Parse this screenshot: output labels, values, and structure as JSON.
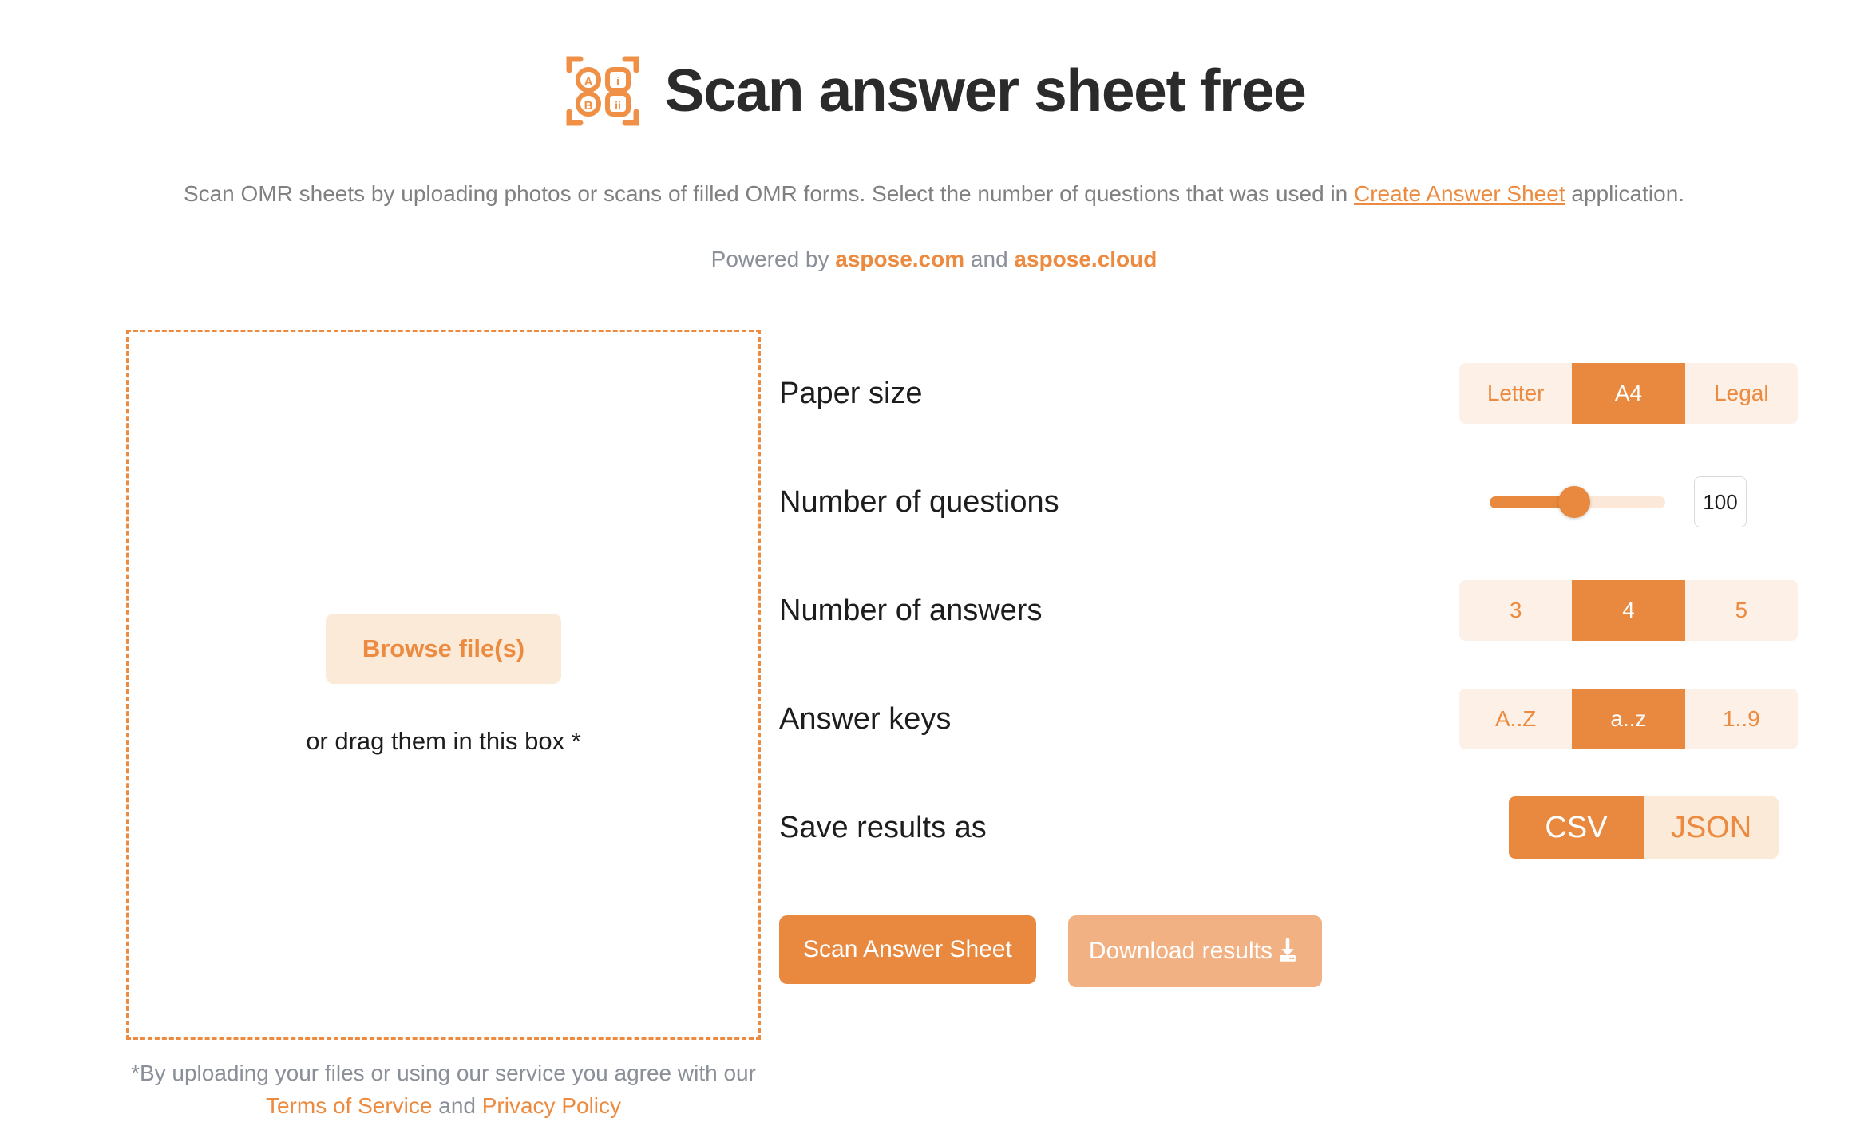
{
  "header": {
    "logo_icon": "omr-scan-frame-icon",
    "logo_labels": [
      "A",
      "i",
      "B",
      "ii"
    ],
    "title": "Scan answer sheet free",
    "subtitle_before": "Scan OMR sheets by uploading photos or scans of filled OMR forms. Select the number of questions that was used in ",
    "subtitle_link": "Create Answer Sheet",
    "subtitle_after": " application.",
    "powered_before": "Powered by ",
    "powered_link1": "aspose.com",
    "powered_middle": " and ",
    "powered_link2": "aspose.cloud"
  },
  "upload": {
    "browse_label": "Browse file(s)",
    "drag_text": "or drag them in this box *",
    "legal_before": "*By uploading your files or using our service you agree with our ",
    "legal_link1": "Terms of Service",
    "legal_middle": " and ",
    "legal_link2": "Privacy Policy"
  },
  "settings": {
    "paper_size": {
      "label": "Paper size",
      "options": [
        "Letter",
        "A4",
        "Legal"
      ],
      "selected": "A4"
    },
    "num_questions": {
      "label": "Number of questions",
      "value": "100",
      "slider_percent": 48
    },
    "num_answers": {
      "label": "Number of answers",
      "options": [
        "3",
        "4",
        "5"
      ],
      "selected": "4"
    },
    "answer_keys": {
      "label": "Answer keys",
      "options": [
        "A..Z",
        "a..z",
        "1..9"
      ],
      "selected": "a..z"
    },
    "save_as": {
      "label": "Save results as",
      "options": [
        "CSV",
        "JSON"
      ],
      "selected": "CSV"
    }
  },
  "actions": {
    "scan_label": "Scan Answer Sheet",
    "download_label": "Download results",
    "download_icon": "download-icon"
  },
  "colors": {
    "accent": "#e8893f",
    "accent_light": "#fcead9",
    "accent_disabled": "#f2b183",
    "text_muted": "#808080"
  }
}
